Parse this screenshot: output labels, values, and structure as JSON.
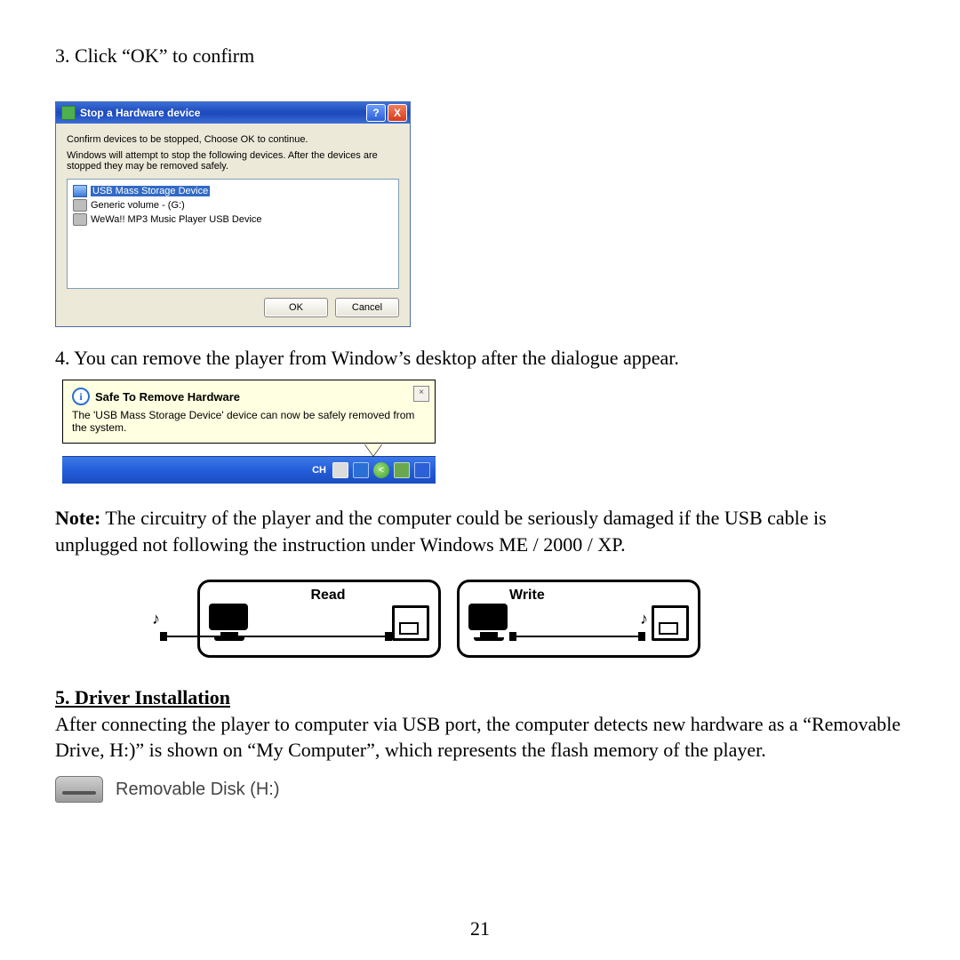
{
  "page_number": "21",
  "steps": {
    "s3": "3. Click “OK” to confirm",
    "s4": "4. You can remove the player from Window’s desktop after the dialogue appear."
  },
  "note_label": "Note:",
  "note_text": "  The circuitry of the player and the computer could be seriously damaged if the USB cable is unplugged not following the instruction under Windows ME / 2000 / XP.",
  "section5_heading": "5.  Driver Installation",
  "section5_body": "After connecting the player to computer via USB port, the computer detects new hardware as a “Removable Drive, H:)” is shown on “My Computer”, which represents the flash memory of the player.",
  "dialog": {
    "title": "Stop a Hardware device",
    "msg1": "Confirm devices to be stopped, Choose OK to continue.",
    "msg2": "Windows will attempt to stop the following devices. After the devices are stopped they may be removed safely.",
    "items": [
      "USB Mass Storage Device",
      "Generic volume - (G:)",
      "WeWa!! MP3 Music Player USB Device"
    ],
    "ok": "OK",
    "cancel": "Cancel",
    "help_glyph": "?",
    "close_glyph": "X"
  },
  "balloon": {
    "title": "Safe To Remove Hardware",
    "body": "The 'USB Mass Storage Device' device can now be safely removed from the system.",
    "close_glyph": "×",
    "taskbar_label": "CH",
    "arrow_glyph": "<"
  },
  "rw": {
    "read": "Read",
    "write": "Write",
    "note_glyph": "♪"
  },
  "drive_label": "Removable Disk (H:)"
}
